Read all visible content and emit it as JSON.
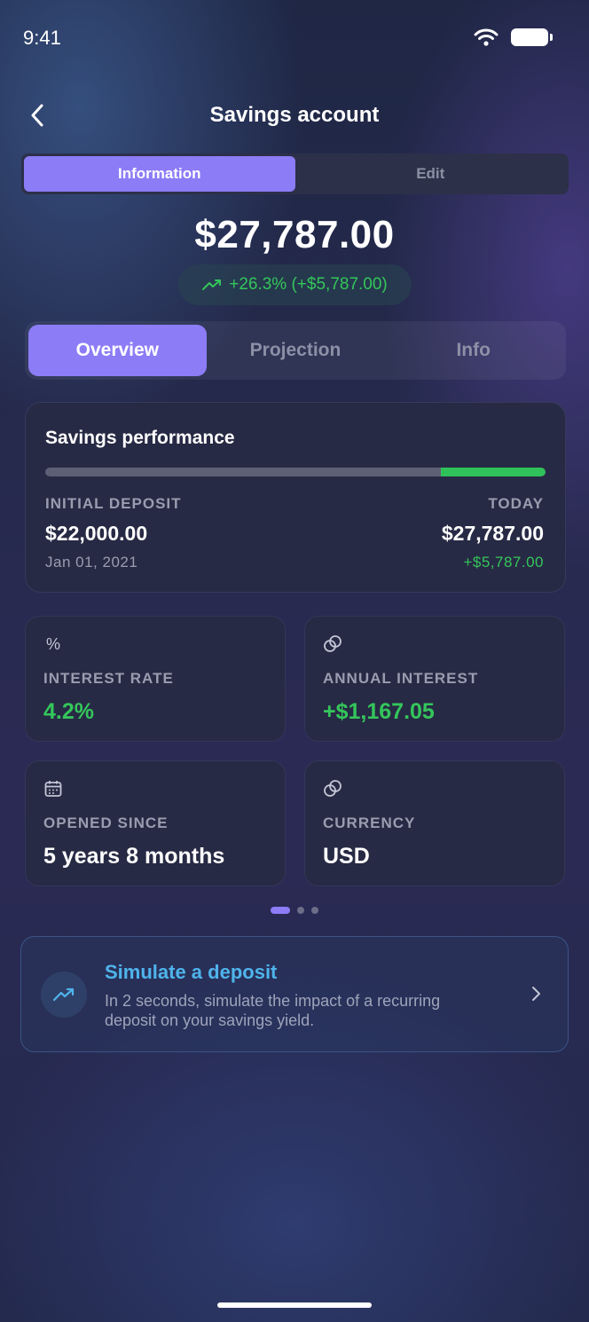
{
  "status_bar": {
    "time": "9:41"
  },
  "header": {
    "title": "Savings account"
  },
  "segmented": {
    "items": [
      "Information",
      "Edit"
    ],
    "active": "Information"
  },
  "balance": {
    "amount": "$27,787.00",
    "change": "+26.3% (+$5,787.00)"
  },
  "tabs": {
    "items": [
      "Overview",
      "Projection",
      "Info"
    ],
    "active": "Overview"
  },
  "performance": {
    "title": "Savings performance",
    "progress_initial_fraction": 0.79,
    "initial_label": "INITIAL DEPOSIT",
    "initial_value": "$22,000.00",
    "initial_date": "Jan 01, 2021",
    "today_label": "TODAY",
    "today_value": "$27,787.00",
    "today_gain": "+$5,787.00"
  },
  "stats": [
    {
      "icon": "percent-icon",
      "label": "INTEREST RATE",
      "value": "4.2%"
    },
    {
      "icon": "coins-icon",
      "label": "ANNUAL INTEREST",
      "value": "+$1,167.05"
    },
    {
      "icon": "calendar-icon",
      "label": "OPENED SINCE",
      "value": "5 years 8 months"
    },
    {
      "icon": "coins-icon",
      "label": "CURRENCY",
      "value": "USD"
    }
  ],
  "pagination": {
    "pages": 3,
    "current": 1
  },
  "simulate": {
    "title": "Simulate a deposit",
    "text": "In 2 seconds, simulate the impact of a recurring deposit on your savings yield."
  },
  "colors": {
    "accent": "#8c7cf6",
    "positive": "#34c65b",
    "link": "#4fb4ec",
    "card": "#272a44"
  }
}
